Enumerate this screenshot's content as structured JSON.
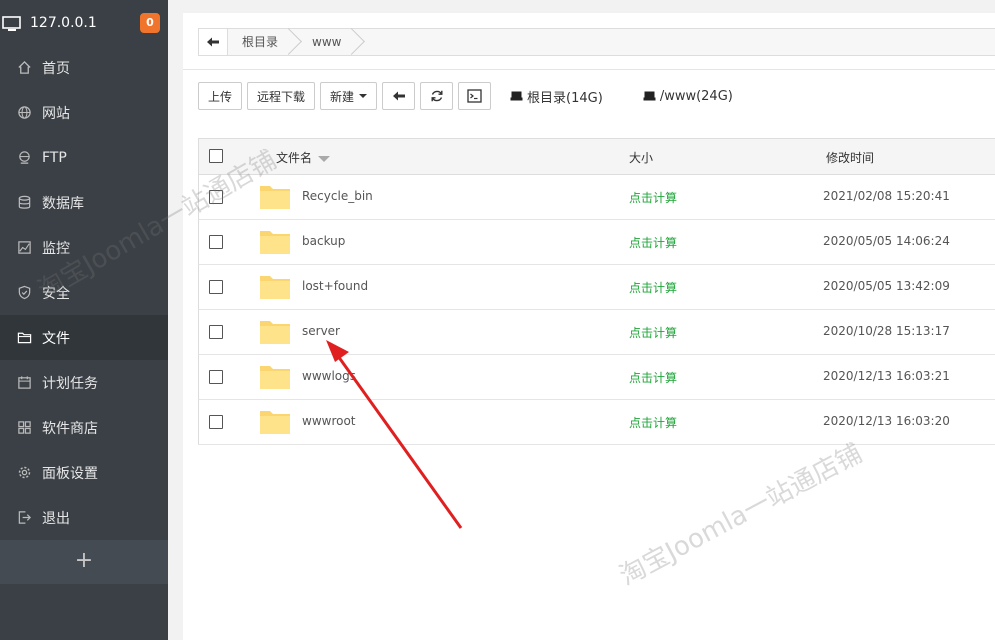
{
  "header": {
    "server_ip": "127.0.0.1",
    "notification_count": "0"
  },
  "sidebar": {
    "items": [
      {
        "label": "首页",
        "icon": "home-icon"
      },
      {
        "label": "网站",
        "icon": "globe-icon"
      },
      {
        "label": "FTP",
        "icon": "ftp-globe-icon"
      },
      {
        "label": "数据库",
        "icon": "database-icon"
      },
      {
        "label": "监控",
        "icon": "monitor-chart-icon"
      },
      {
        "label": "安全",
        "icon": "shield-icon"
      },
      {
        "label": "文件",
        "icon": "folder-icon",
        "active": true
      },
      {
        "label": "计划任务",
        "icon": "calendar-icon"
      },
      {
        "label": "软件商店",
        "icon": "grid-icon"
      },
      {
        "label": "面板设置",
        "icon": "gear-icon"
      },
      {
        "label": "退出",
        "icon": "logout-icon"
      }
    ],
    "add_label": "+"
  },
  "breadcrumb": {
    "items": [
      "根目录",
      "www"
    ]
  },
  "toolbar": {
    "upload": "上传",
    "remote_download": "远程下载",
    "new": "新建",
    "disks": [
      "根目录(14G)",
      "/www(24G)"
    ]
  },
  "table": {
    "headers": {
      "name": "文件名",
      "size": "大小",
      "modified": "修改时间"
    },
    "rows": [
      {
        "name": "Recycle_bin",
        "size": "点击计算",
        "modified": "2021/02/08 15:20:41"
      },
      {
        "name": "backup",
        "size": "点击计算",
        "modified": "2020/05/05 14:06:24"
      },
      {
        "name": "lost+found",
        "size": "点击计算",
        "modified": "2020/05/05 13:42:09"
      },
      {
        "name": "server",
        "size": "点击计算",
        "modified": "2020/10/28 15:13:17"
      },
      {
        "name": "wwwlogs",
        "size": "点击计算",
        "modified": "2020/12/13 16:03:21"
      },
      {
        "name": "wwwroot",
        "size": "点击计算",
        "modified": "2020/12/13 16:03:20"
      }
    ]
  },
  "watermarks": [
    "淘宝Joomla一站通店铺",
    "淘宝Joomla一站通店铺"
  ],
  "colors": {
    "sidebar_bg": "#3b4046",
    "accent_green": "#20a53a",
    "badge_orange": "#f0742b",
    "arrow_red": "#e02020"
  }
}
